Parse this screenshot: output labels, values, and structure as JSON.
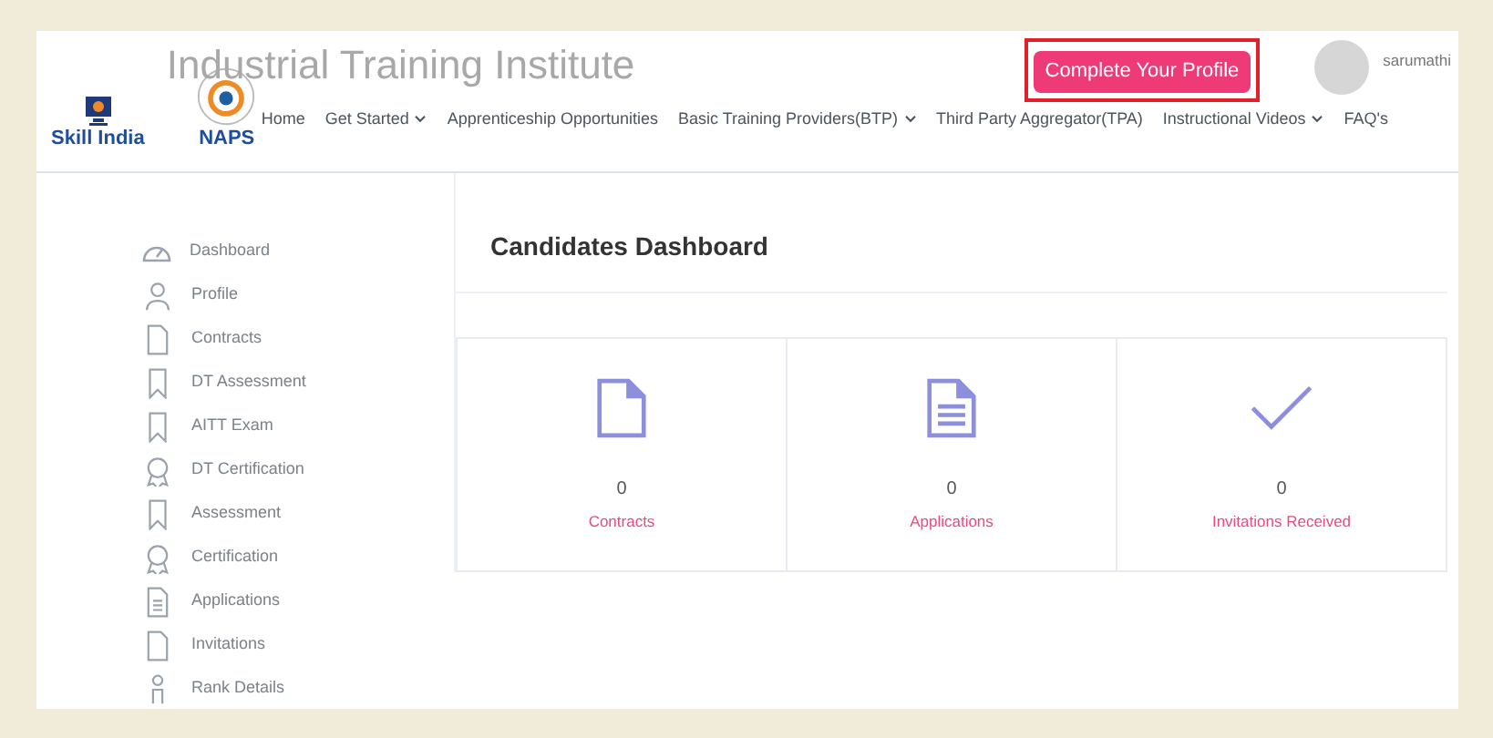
{
  "header": {
    "site_title": "Industrial Training Institute",
    "logos": [
      {
        "kind": "skill",
        "label": "Skill India"
      },
      {
        "kind": "naps",
        "label": "NAPS"
      }
    ],
    "cta_button": "Complete Your Profile",
    "user": {
      "name": "sarumathi"
    }
  },
  "nav": [
    {
      "label": "Home",
      "dropdown": false
    },
    {
      "label": "Get Started",
      "dropdown": true
    },
    {
      "label": "Apprenticeship Opportunities",
      "dropdown": false
    },
    {
      "label": "Basic Training Providers(BTP)",
      "dropdown": true
    },
    {
      "label": "Third Party Aggregator(TPA)",
      "dropdown": false
    },
    {
      "label": "Instructional Videos",
      "dropdown": true
    },
    {
      "label": "FAQ's",
      "dropdown": false
    }
  ],
  "sidebar": {
    "items": [
      {
        "label": "Dashboard",
        "kind": "gauge"
      },
      {
        "label": "Profile",
        "kind": "user"
      },
      {
        "label": "Contracts",
        "kind": "file"
      },
      {
        "label": "DT Assessment",
        "kind": "bookmark"
      },
      {
        "label": "AITT Exam",
        "kind": "bookmark"
      },
      {
        "label": "DT Certification",
        "kind": "award"
      },
      {
        "label": "Assessment",
        "kind": "bookmark"
      },
      {
        "label": "Certification",
        "kind": "award"
      },
      {
        "label": "Applications",
        "kind": "doc"
      },
      {
        "label": "Invitations",
        "kind": "file"
      },
      {
        "label": "Rank Details",
        "kind": "person"
      }
    ]
  },
  "dashboard": {
    "title": "Candidates Dashboard",
    "cards": [
      {
        "kind": "file",
        "count": "0",
        "label": "Contracts"
      },
      {
        "kind": "doc",
        "count": "0",
        "label": "Applications"
      },
      {
        "kind": "check",
        "count": "0",
        "label": "Invitations Received"
      }
    ]
  }
}
